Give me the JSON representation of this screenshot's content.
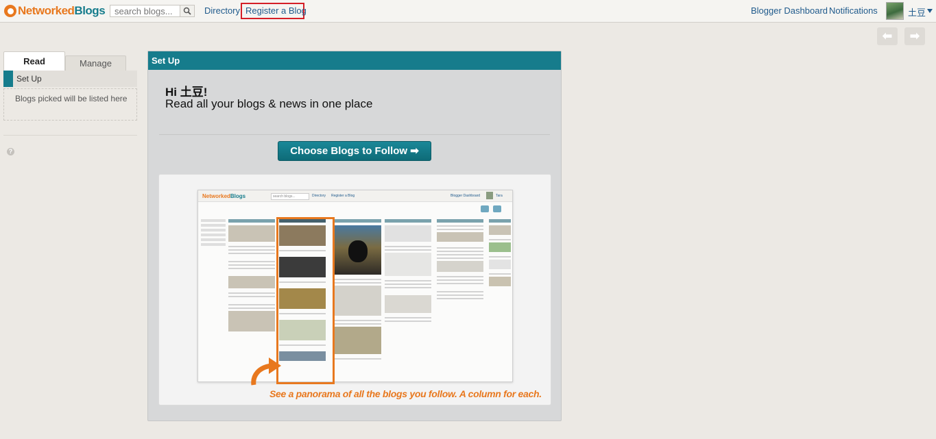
{
  "header": {
    "logo": {
      "part1": "Networked",
      "part2": "Blogs"
    },
    "search": {
      "placeholder": "search blogs...",
      "icon": "search-icon"
    },
    "nav": {
      "directory": "Directory",
      "register": "Register a Blog"
    },
    "right": {
      "dashboard": "Blogger Dashboard",
      "notifications": "Notifications",
      "user": "土豆"
    },
    "history": {
      "back_icon": "arrow-left-icon",
      "forward_icon": "arrow-right-icon"
    }
  },
  "sidebar": {
    "tabs": [
      {
        "label": "Read",
        "active": true
      },
      {
        "label": "Manage",
        "active": false
      }
    ],
    "setup_item": "Set Up",
    "note": "Blogs picked will be listed here"
  },
  "main": {
    "title": "Set Up",
    "greeting_prefix": "Hi ",
    "greeting_name": "土豆!",
    "tagline": "Read all your blogs & news in one place",
    "button": "Choose Blogs to Follow ➡",
    "preview": {
      "caption": "See a panorama of all the blogs you follow. A column for each.",
      "mock": {
        "logo_part1": "Networked",
        "logo_part2": "Blogs",
        "search": "search blogs...",
        "directory": "Directory",
        "register": "Register a Blog",
        "dashboard": "Blogger Dashboard",
        "user": "Tara"
      }
    }
  },
  "colors": {
    "brand_orange": "#e8781e",
    "brand_teal": "#167c8c",
    "highlight_red": "#d51e26"
  }
}
